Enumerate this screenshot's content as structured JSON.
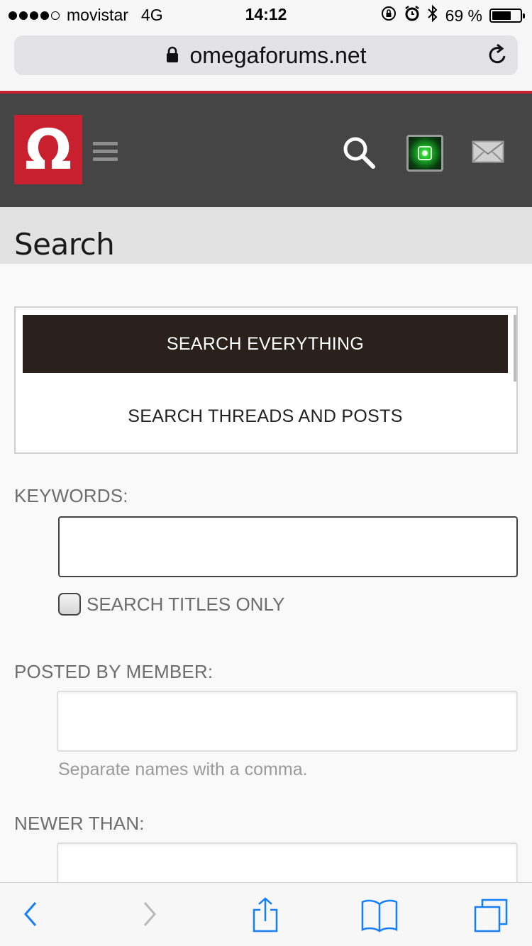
{
  "status_bar": {
    "carrier": "movistar",
    "network": "4G",
    "time": "14:12",
    "battery_percent": "69 %",
    "battery_level": 0.69
  },
  "browser": {
    "url": "omegaforums.net"
  },
  "site": {
    "logo_glyph": "Ω",
    "brand_color": "#c8202f",
    "header_color": "#454545"
  },
  "page": {
    "title": "Search",
    "tabs": [
      {
        "label": "SEARCH EVERYTHING",
        "active": true
      },
      {
        "label": "SEARCH THREADS AND POSTS",
        "active": false
      }
    ]
  },
  "form": {
    "keywords_label": "KEYWORDS:",
    "keywords_value": "",
    "titles_only_label": "SEARCH TITLES ONLY",
    "titles_only_checked": false,
    "posted_by_label": "POSTED BY MEMBER:",
    "posted_by_value": "",
    "posted_by_hint": "Separate names with a comma.",
    "newer_than_label": "NEWER THAN:",
    "newer_than_value": ""
  },
  "toolbar": {
    "icons": [
      "back-icon",
      "forward-icon",
      "share-icon",
      "bookmarks-icon",
      "tabs-icon"
    ],
    "accent_color": "#157efb"
  }
}
